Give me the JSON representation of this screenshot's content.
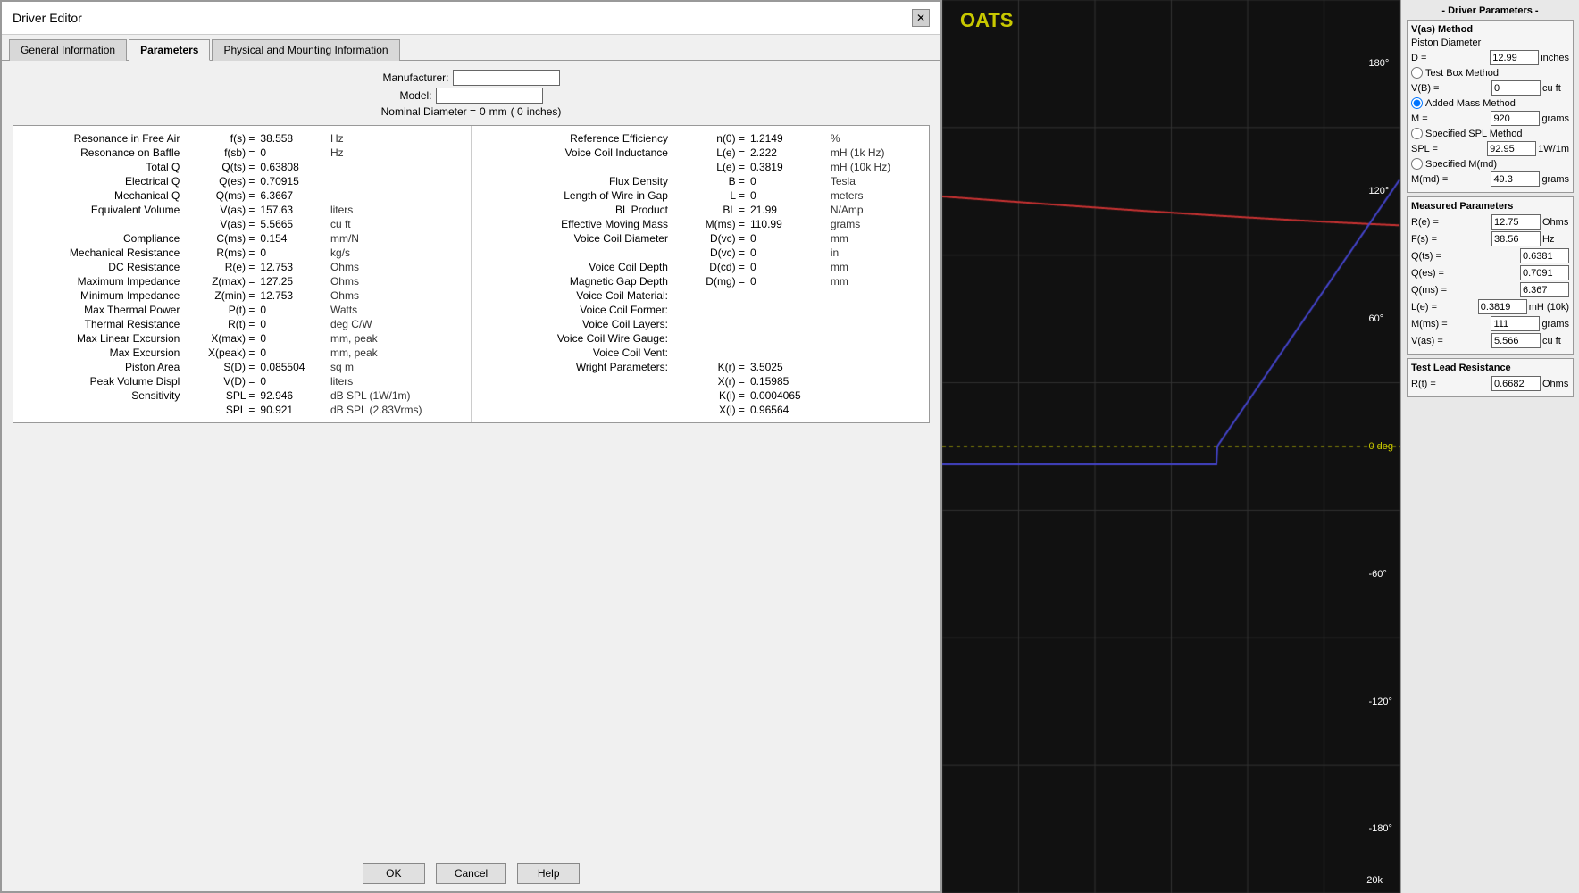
{
  "dialog": {
    "title": "Driver Editor",
    "close_label": "✕"
  },
  "tabs": [
    {
      "label": "General Information",
      "active": false
    },
    {
      "label": "Parameters",
      "active": true
    },
    {
      "label": "Physical and Mounting Information",
      "active": false
    }
  ],
  "header": {
    "manufacturer_label": "Manufacturer:",
    "manufacturer_value": "",
    "model_label": "Model:",
    "model_value": "",
    "nominal_diameter_label": "Nominal Diameter =",
    "nominal_diameter_value": "0",
    "nominal_diameter_unit": "mm",
    "nominal_diameter_paren": "( 0",
    "nominal_diameter_inches": "inches)"
  },
  "left_params": [
    {
      "label": "Resonance in Free Air",
      "key": "f(s) =",
      "value": "38.558",
      "unit": "Hz"
    },
    {
      "label": "Resonance on Baffle",
      "key": "f(sb) =",
      "value": "0",
      "unit": "Hz"
    },
    {
      "label": "Total Q",
      "key": "Q(ts) =",
      "value": "0.63808",
      "unit": ""
    },
    {
      "label": "Electrical Q",
      "key": "Q(es) =",
      "value": "0.70915",
      "unit": ""
    },
    {
      "label": "Mechanical Q",
      "key": "Q(ms) =",
      "value": "6.3667",
      "unit": ""
    },
    {
      "label": "Equivalent Volume",
      "key": "V(as) =",
      "value": "157.63",
      "unit": "liters"
    },
    {
      "label": "",
      "key": "V(as) =",
      "value": "5.5665",
      "unit": "cu ft"
    },
    {
      "label": "Compliance",
      "key": "C(ms) =",
      "value": "0.154",
      "unit": "mm/N"
    },
    {
      "label": "Mechanical Resistance",
      "key": "R(ms) =",
      "value": "0",
      "unit": "kg/s"
    },
    {
      "label": "DC Resistance",
      "key": "R(e) =",
      "value": "12.753",
      "unit": "Ohms"
    },
    {
      "label": "Maximum Impedance",
      "key": "Z(max) =",
      "value": "127.25",
      "unit": "Ohms"
    },
    {
      "label": "Minimum Impedance",
      "key": "Z(min) =",
      "value": "12.753",
      "unit": "Ohms"
    },
    {
      "label": "Max Thermal Power",
      "key": "P(t) =",
      "value": "0",
      "unit": "Watts"
    },
    {
      "label": "Thermal Resistance",
      "key": "R(t) =",
      "value": "0",
      "unit": "deg C/W"
    },
    {
      "label": "Max Linear Excursion",
      "key": "X(max) =",
      "value": "0",
      "unit": "mm, peak"
    },
    {
      "label": "Max Excursion",
      "key": "X(peak) =",
      "value": "0",
      "unit": "mm, peak"
    },
    {
      "label": "Piston Area",
      "key": "S(D) =",
      "value": "0.085504",
      "unit": "sq m"
    },
    {
      "label": "Peak Volume Displ",
      "key": "V(D) =",
      "value": "0",
      "unit": "liters"
    },
    {
      "label": "Sensitivity",
      "key": "SPL =",
      "value": "92.946",
      "unit": "dB SPL (1W/1m)"
    },
    {
      "label": "",
      "key": "SPL =",
      "value": "90.921",
      "unit": "dB SPL (2.83Vrms)"
    }
  ],
  "right_params": [
    {
      "label": "Reference Efficiency",
      "key": "n(0) =",
      "value": "1.2149",
      "unit": "%"
    },
    {
      "label": "Voice Coil Inductance",
      "key": "L(e) =",
      "value": "2.222",
      "unit": "mH (1k Hz)"
    },
    {
      "label": "",
      "key": "L(e) =",
      "value": "0.3819",
      "unit": "mH (10k Hz)"
    },
    {
      "label": "Flux Density",
      "key": "B =",
      "value": "0",
      "unit": "Tesla"
    },
    {
      "label": "Length of Wire in Gap",
      "key": "L =",
      "value": "0",
      "unit": "meters"
    },
    {
      "label": "BL Product",
      "key": "BL =",
      "value": "21.99",
      "unit": "N/Amp"
    },
    {
      "label": "Effective Moving Mass",
      "key": "M(ms) =",
      "value": "110.99",
      "unit": "grams"
    },
    {
      "label": "Voice Coil Diameter",
      "key": "D(vc) =",
      "value": "0",
      "unit": "mm"
    },
    {
      "label": "",
      "key": "D(vc) =",
      "value": "0",
      "unit": "in"
    },
    {
      "label": "Voice Coil Depth",
      "key": "D(cd) =",
      "value": "0",
      "unit": "mm"
    },
    {
      "label": "Magnetic Gap Depth",
      "key": "D(mg) =",
      "value": "0",
      "unit": "mm"
    },
    {
      "label": "Voice Coil Material:",
      "key": "",
      "value": "",
      "unit": ""
    },
    {
      "label": "Voice Coil Former:",
      "key": "",
      "value": "",
      "unit": ""
    },
    {
      "label": "Voice Coil Layers:",
      "key": "",
      "value": "",
      "unit": ""
    },
    {
      "label": "Voice Coil Wire Gauge:",
      "key": "",
      "value": "",
      "unit": ""
    },
    {
      "label": "Voice Coil Vent:",
      "key": "",
      "value": "",
      "unit": ""
    },
    {
      "label": "Wright Parameters:",
      "key": "K(r) =",
      "value": "3.5025",
      "unit": ""
    },
    {
      "label": "",
      "key": "X(r) =",
      "value": "0.15985",
      "unit": ""
    },
    {
      "label": "",
      "key": "K(i) =",
      "value": "0.0004065",
      "unit": ""
    },
    {
      "label": "",
      "key": "X(i) =",
      "value": "0.96564",
      "unit": ""
    }
  ],
  "footer": {
    "ok_label": "OK",
    "cancel_label": "Cancel",
    "help_label": "Help"
  },
  "chart": {
    "label": "OATS",
    "y_labels": [
      "180°",
      "120°",
      "60°",
      "0 deg",
      "-60°",
      "-120°",
      "-180°"
    ],
    "x_label": "20k"
  },
  "driver_params": {
    "title": "- Driver Parameters -",
    "vas_method_label": "V(as) Method",
    "piston_diameter_label": "Piston Diameter",
    "d_label": "D =",
    "d_value": "12.99",
    "d_unit": "inches",
    "test_box_label": "Test Box Method",
    "vb_label": "V(B) =",
    "vb_value": "0",
    "vb_unit": "cu ft",
    "added_mass_label": "Added Mass Method",
    "m_label": "M =",
    "m_value": "920",
    "m_unit": "grams",
    "specified_spl_label": "Specified SPL Method",
    "spl_label": "SPL =",
    "spl_value": "92.95",
    "spl_unit": "1W/1m",
    "specified_mmd_label": "Specified M(md)",
    "mmd_label": "M(md) =",
    "mmd_value": "49.3",
    "mmd_unit": "grams",
    "measured_params_label": "Measured Parameters",
    "re_label": "R(e) =",
    "re_value": "12.75",
    "re_unit": "Ohms",
    "fs_label": "F(s) =",
    "fs_value": "38.56",
    "fs_unit": "Hz",
    "qts_label": "Q(ts) =",
    "qts_value": "0.6381",
    "qes_label": "Q(es) =",
    "qes_value": "0.7091",
    "qms_label": "Q(ms) =",
    "qms_value": "6.367",
    "le_label": "L(e) =",
    "le_value": "0.3819",
    "le_unit": "mH (10k)",
    "mms_label": "M(ms) =",
    "mms_value": "111",
    "mms_unit": "grams",
    "vas_label": "V(as) =",
    "vas_value": "5.566",
    "vas_unit": "cu ft",
    "test_lead_label": "Test Lead Resistance",
    "rt_label": "R(t) =",
    "rt_value": "0.6682",
    "rt_unit": "Ohms"
  }
}
